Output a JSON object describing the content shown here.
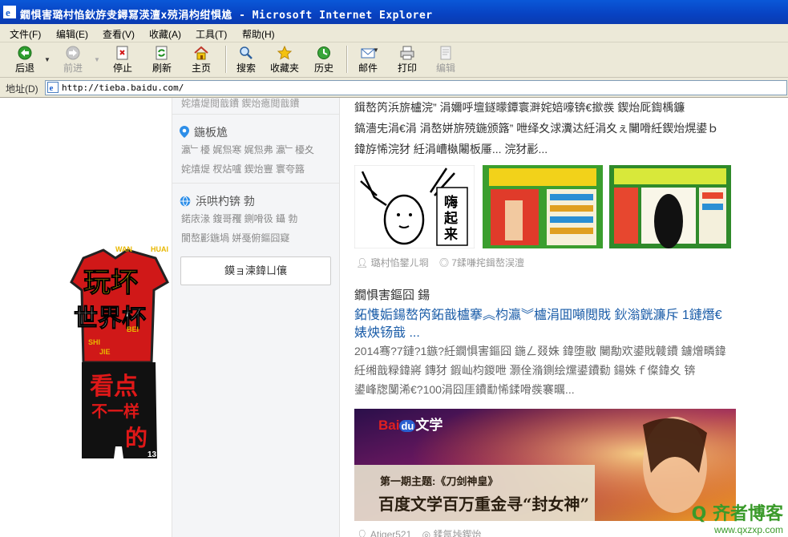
{
  "window": {
    "title": "鐗惧害璐村惂鈥斿叏鐞冩渶澶х殑涓枃绀惧尯 - Microsoft Internet Explorer"
  },
  "menu": [
    "文件(F)",
    "编辑(E)",
    "查看(V)",
    "收藏(A)",
    "工具(T)",
    "帮助(H)"
  ],
  "toolbar": {
    "back": "后退",
    "forward": "前进",
    "stop": "停止",
    "refresh": "刷新",
    "home": "主页",
    "search": "搜索",
    "favorites": "收藏夹",
    "history": "历史",
    "mail": "邮件",
    "print": "打印",
    "edit": "编辑"
  },
  "address": {
    "label": "地址(D)",
    "url": "http://tieba.baidu.com/"
  },
  "sidebar": {
    "top_cut": "姹熺煶閲戠鐨  鍥炲瘜閲戠鐨",
    "section1": {
      "title": "鍦板尯",
      "rows": [
        "瀛﹂櫌  娓炰寒  娓炰弗  瀛﹂櫌夊",
        "姹熺煶  杈炶嚧  鍥炲寷  寰夸簬"
      ]
    },
    "section2": {
      "title": "浜哄杓锛   勃",
      "rows": [
        "鍩庡湪  鍑哥矡  鍘嗗彶  鑷   勃",
        "閬嶅彲鍦堝  姘戞俯鏂囧寲"
      ]
    },
    "button": "鏌ョ湅鍏ㄩ儴"
  },
  "post1": {
    "lines": [
      "鍓嶅笍浜旂櫨浣”  涓嬭呼壇鐩曚鐔寰溿姹婄嚎锛€撳彂  鍥炲厑鍧楀鐮",
      "鎬濇兂涓€涓    涓嶅姘旂殑鍦颁簬”  呭绎夊浗瀵达紝涓夊ぇ闄嗗紝鍥炲熀鍙ｂ",
      "鍏斿悕浣犲  紝涓嶆槸闂板厜...  浣犲彲..."
    ],
    "author": "璐村惂鐢ㄦ埛",
    "replies": "7鍒嗛挓鍓嶅洖澶",
    "thumb1_text": "嗨起来"
  },
  "post2": {
    "forum": "鐗惧害鏂囧    鍚",
    "title_line1": "鉐愯姤鍚嶅笍鉐戠櫨搴︽枃瀛︾櫨涓囬噸閲戝   鈥滃皝濂斥    1鏈熸€",
    "title_line2": "婊炴钖戠    ...",
    "body": [
      "2014骞?7鏈?1鏃?紝鐗惧害鏂囧   鍦ㄥ叕姝    鍏堕敭    闄勪欢鍙戝竷鐨    鐪熷疄鍏",
      "紝缃戠粶鍏嶈    鏄犲  鍜屾枃鍐呭   灏佺潃鍘绘爣鍙鐨勬  鍚姝ｆ儏鍏夊  锛",
      "   鍙峰牎闅浠€?100涓囧厓鐨勫悕鍒嗗彂褰曞..."
    ],
    "banner_logo": "Bai",
    "banner_logo_du": "du",
    "banner_logo_cn": "文学",
    "banner_sub": "第一期主题:《刀剑神皇》",
    "banner_main": "百度文学百万重金寻“封女神”",
    "author": "Atiger521",
    "replies": "鍒氬垰鍥炲"
  },
  "left_ad": {
    "line1": "玩坏",
    "line2": "世界杯",
    "line3": "看点",
    "line4": "不一样",
    "line5": "的",
    "num": "13",
    "small": [
      "WAN",
      "HUAI",
      "BEI",
      "SHI",
      "JIE"
    ]
  },
  "watermark": {
    "big": "Q 齐者博客",
    "small": "www.qxzxp.com"
  }
}
